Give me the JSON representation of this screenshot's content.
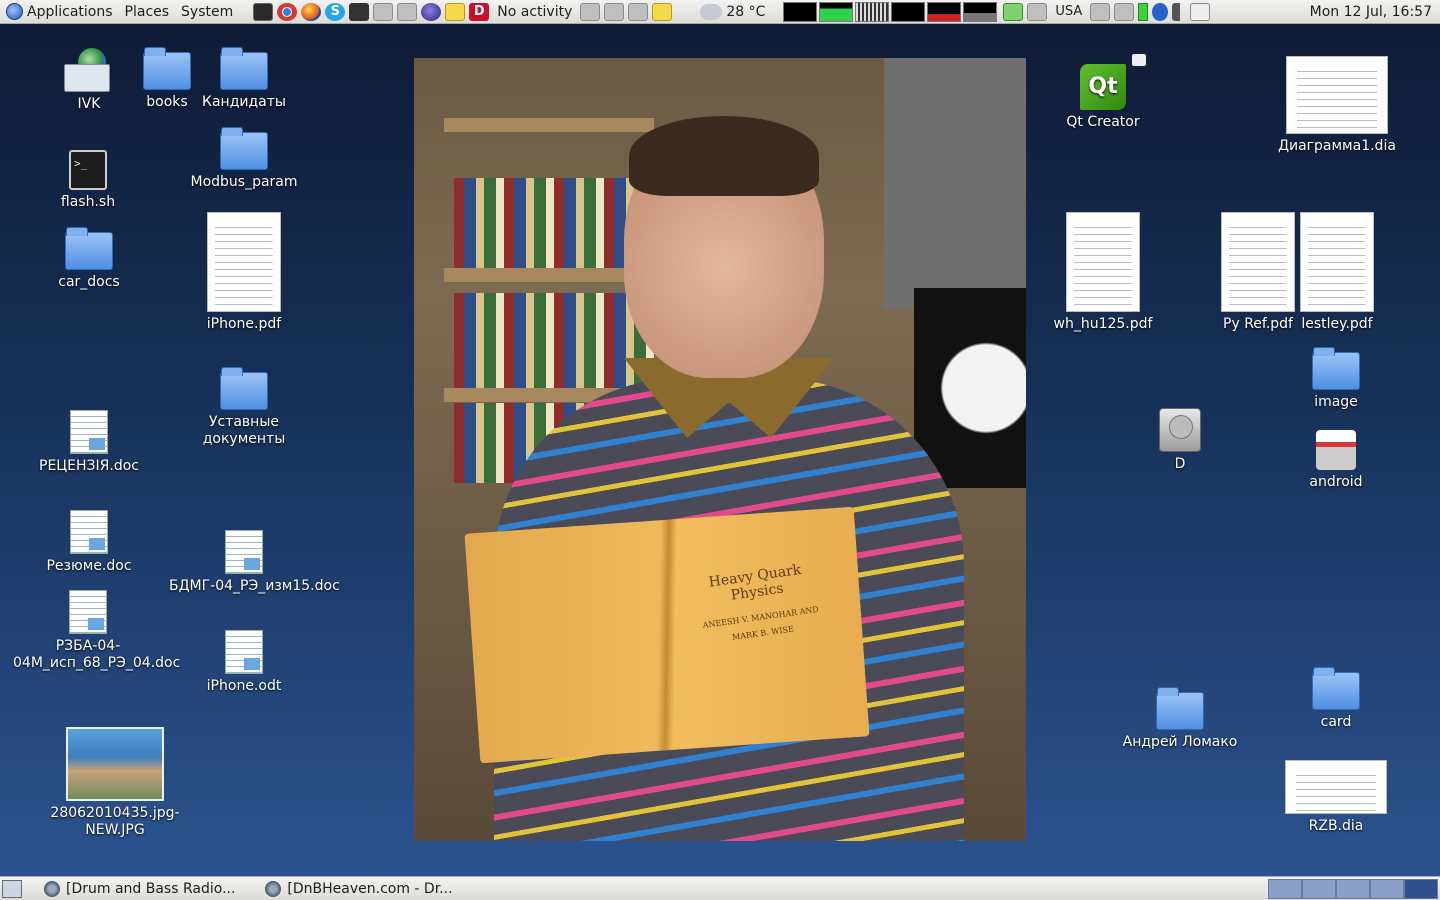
{
  "top_panel": {
    "menus": [
      "Applications",
      "Places",
      "System"
    ],
    "no_activity": "No activity",
    "weather": "28 °C",
    "keyboard_layout": "USA",
    "clock": "Mon 12 Jul, 16:57"
  },
  "desktop_icons": {
    "ivk": "IVK",
    "books": "books",
    "kandidaty": "Кандидаты",
    "flash_sh": "flash.sh",
    "modbus_param": "Modbus_param",
    "car_docs": "car_docs",
    "iphone_pdf": "iPhone.pdf",
    "ustavnye": "Уставные документы",
    "recenzia": "РЕЦЕНЗІЯ.doc",
    "rezume": "Резюме.doc",
    "bdmg": "БДМГ-04_РЭ_изм15.doc",
    "rzba": "РЗБА-04-04М_исп_68_РЭ_04.doc",
    "iphone_odt": "iPhone.odt",
    "photo_jpg": "28062010435.jpg-NEW.JPG",
    "qt_creator": "Qt Creator",
    "diagramma": "Диаграмма1.dia",
    "wh_hu125": "wh_hu125.pdf",
    "py_ref": "Py Ref.pdf",
    "lestley": "lestley.pdf",
    "image": "image",
    "d_drive": "D",
    "android": "android",
    "andrey": "Андрей Ломако",
    "card": "card",
    "rzb_dia": "RZB.dia"
  },
  "wallpaper": {
    "book_title": "Heavy Quark Physics",
    "book_authors": "ANEESH V. MANOHAR AND MARK B. WISE"
  },
  "bottom_panel": {
    "tasks": [
      "[Drum and Bass Radio...",
      "[DnBHeaven.com - Dr..."
    ]
  },
  "colors": {
    "panel": "#dcdcd8",
    "desktop_top": "#0e1a33",
    "desktop_bottom": "#2d5592"
  }
}
